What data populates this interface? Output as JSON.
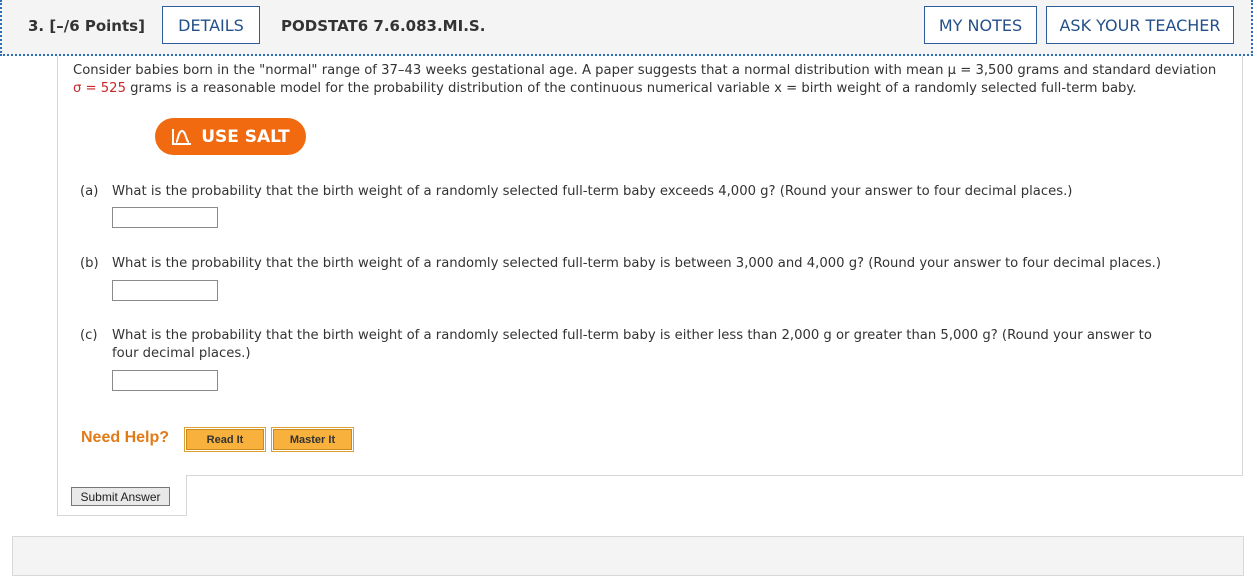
{
  "header": {
    "question_points": "3.  [–/6 Points]",
    "details_label": "DETAILS",
    "problem_code": "PODSTAT6 7.6.083.MI.S.",
    "my_notes_label": "MY NOTES",
    "ask_teacher_label": "ASK YOUR TEACHER"
  },
  "intro": {
    "line1": "Consider babies born in the \"normal\" range of 37–43 weeks gestational age. A paper suggests that a normal distribution with mean μ = 3,500 grams and standard deviation",
    "line2_sigma": "σ = 525",
    "line2_rest": " grams is a reasonable model for the probability distribution of the continuous numerical variable x = birth weight of a randomly selected full-term baby."
  },
  "salt": {
    "label": "USE SALT"
  },
  "parts": [
    {
      "label": "(a)",
      "text": "What is the probability that the birth weight of a randomly selected full-term baby exceeds 4,000 g? (Round your answer to four decimal places.)",
      "value": ""
    },
    {
      "label": "(b)",
      "text": "What is the probability that the birth weight of a randomly selected full-term baby is between 3,000 and 4,000 g? (Round your answer to four decimal places.)",
      "value": ""
    },
    {
      "label": "(c)",
      "text": "What is the probability that the birth weight of a randomly selected full-term baby is either less than 2,000 g or greater than 5,000 g? (Round your answer to four decimal places.)",
      "value": ""
    }
  ],
  "help": {
    "label": "Need Help?",
    "read_it": "Read It",
    "master_it": "Master It"
  },
  "submit": {
    "label": "Submit Answer"
  },
  "colors": {
    "accent": "#2d5d9a",
    "salt": "#f26a10",
    "help": "#e07b18",
    "sigma": "#c62828"
  }
}
